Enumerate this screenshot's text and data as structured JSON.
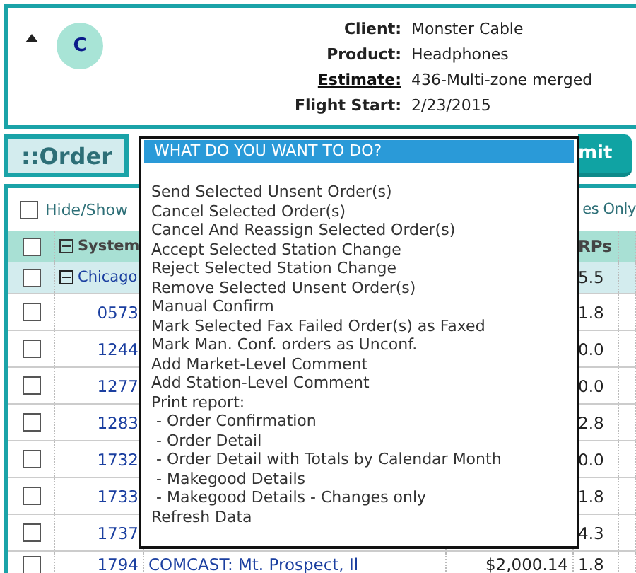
{
  "header": {
    "avatar_letter": "C",
    "fields": [
      {
        "label": "Client:",
        "value": "Monster Cable",
        "link": false
      },
      {
        "label": "Product:",
        "value": "Headphones",
        "link": false
      },
      {
        "label": "Estimate:",
        "value": "436-Multi-zone merged",
        "link": true
      },
      {
        "label": "Flight Start:",
        "value": "2/23/2015",
        "link": false
      }
    ]
  },
  "order_bar": {
    "title": "::Order",
    "button": "mit"
  },
  "options": {
    "checkbox_label": "Hide/Show",
    "checked": false,
    "right_text": "es Only"
  },
  "table": {
    "header_checked": false,
    "columns": [
      "System",
      "RPs"
    ],
    "group": {
      "name": "Chicago",
      "expanded": true,
      "checked": false,
      "value": "5.5"
    },
    "rows": [
      {
        "code": "0573",
        "value": "1.8",
        "checked": false
      },
      {
        "code": "1244",
        "value": "0.0",
        "checked": false
      },
      {
        "code": "1277",
        "value": "0.0",
        "checked": false
      },
      {
        "code": "1283",
        "value": "2.8",
        "checked": false
      },
      {
        "code": "1732",
        "value": "0.0",
        "checked": false
      },
      {
        "code": "1733",
        "value": "1.8",
        "checked": false
      },
      {
        "code": "1737",
        "value": "4.3",
        "checked": false
      },
      {
        "code": "1794",
        "station": "COMCAST: Mt. Prospect, Il",
        "amount": "$2,000.14",
        "value": "1.8",
        "checked": false
      }
    ]
  },
  "menu": {
    "title": "WHAT DO YOU WANT TO DO?",
    "items": [
      "Send Selected Unsent Order(s)",
      "Cancel Selected Order(s)",
      "Cancel And Reassign Selected Order(s)",
      "Accept Selected Station Change",
      "Reject Selected Station Change",
      "Remove Selected Unsent Order(s)",
      "Manual Confirm",
      "Mark Selected Fax Failed Order(s) as Faxed",
      "Mark Man. Conf. orders as Unconf.",
      "Add Market-Level Comment",
      "Add Station-Level Comment",
      "Print report:",
      " - Order Confirmation",
      " - Order Detail",
      " - Order Detail with Totals by Calendar Month",
      " - Makegood Details",
      " - Makegood Details - Changes only",
      "Refresh Data"
    ]
  }
}
